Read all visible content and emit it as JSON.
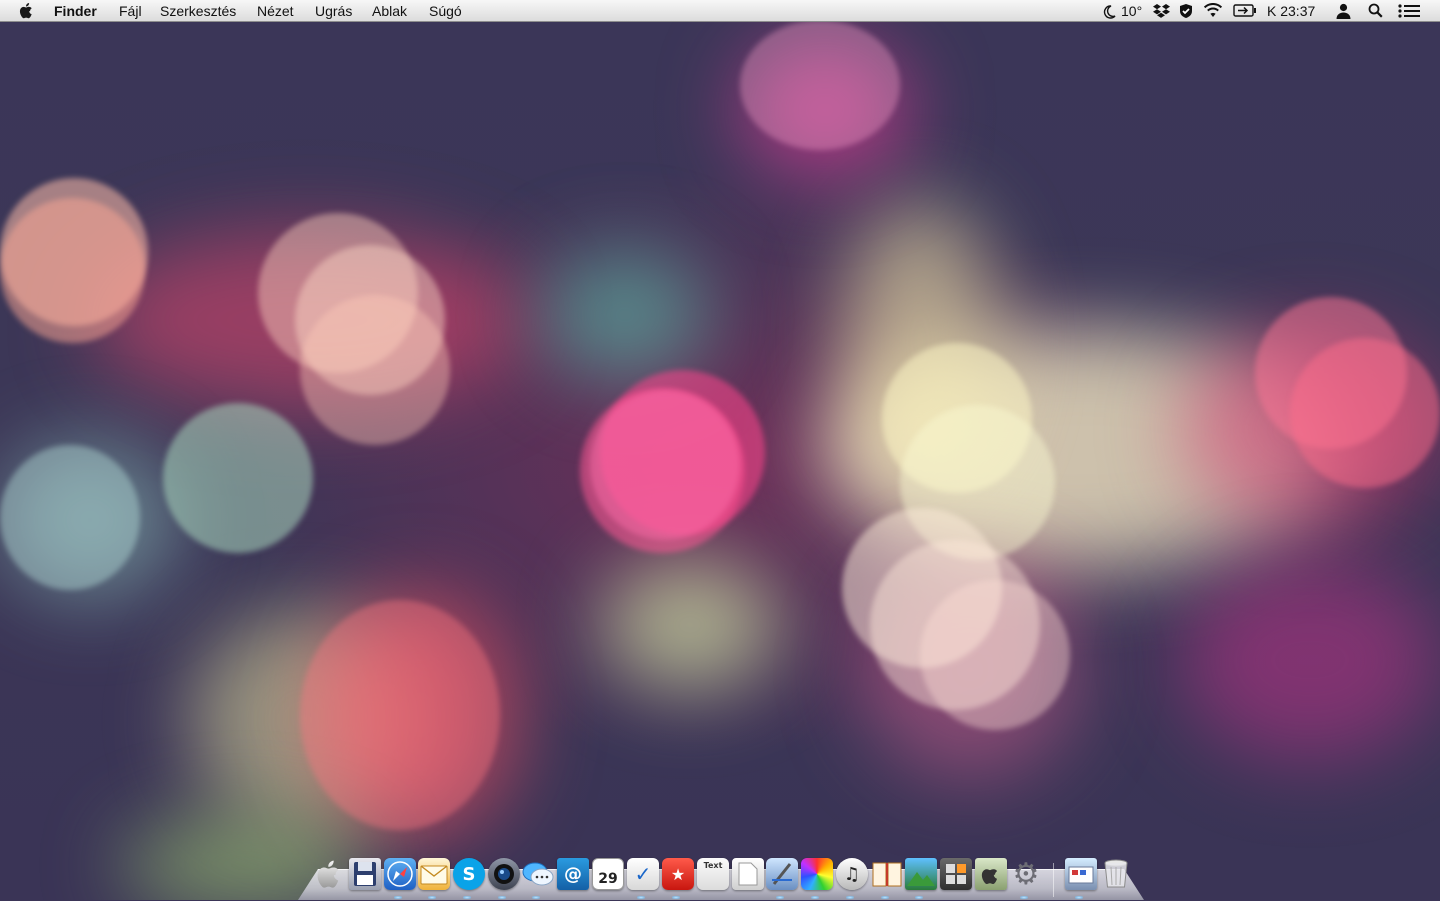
{
  "menubar": {
    "app_name": "Finder",
    "menus": [
      "Fájl",
      "Szerkesztés",
      "Nézet",
      "Ugrás",
      "Ablak",
      "Súgó"
    ],
    "status": {
      "weather": "10°",
      "clock": "K 23:37"
    }
  },
  "dock": {
    "items": [
      {
        "icon": "apple-icon",
        "name": "Apple"
      },
      {
        "icon": "floppy-icon",
        "name": "Floppy"
      },
      {
        "icon": "safari-icon",
        "name": "Safari"
      },
      {
        "icon": "mail-icon",
        "name": "Mail"
      },
      {
        "icon": "skype-icon",
        "name": "Skype",
        "glyph": "S"
      },
      {
        "icon": "camera-icon",
        "name": "Camera"
      },
      {
        "icon": "messages-icon",
        "name": "Messages"
      },
      {
        "icon": "address-book-icon",
        "name": "Address Book",
        "glyph": "@"
      },
      {
        "icon": "calendar-icon",
        "name": "Calendar",
        "glyph": "29"
      },
      {
        "icon": "reminders-icon",
        "name": "Reminders",
        "glyph": "✓"
      },
      {
        "icon": "bookmark-star-icon",
        "name": "Bookmarks",
        "glyph": "★"
      },
      {
        "icon": "textedit-icon",
        "name": "TextEdit",
        "glyph": "Text"
      },
      {
        "icon": "preview-icon",
        "name": "Preview"
      },
      {
        "icon": "xcode-icon",
        "name": "Xcode"
      },
      {
        "icon": "color-wheel-icon",
        "name": "Colors"
      },
      {
        "icon": "itunes-icon",
        "name": "iTunes",
        "glyph": "♫"
      },
      {
        "icon": "ibooks-icon",
        "name": "iBooks"
      },
      {
        "icon": "photos-icon",
        "name": "Photos"
      },
      {
        "icon": "calculator-icon",
        "name": "Calculator"
      },
      {
        "icon": "utility-icon",
        "name": "Utility"
      },
      {
        "icon": "system-preferences-icon",
        "name": "System Preferences",
        "glyph": "⚙"
      },
      {
        "icon": "downloads-stack-icon",
        "name": "Downloads"
      },
      {
        "icon": "trash-icon",
        "name": "Trash"
      }
    ],
    "running": [
      2,
      3,
      4,
      5,
      6,
      9,
      10,
      13,
      14,
      15,
      16,
      17,
      20,
      21
    ]
  },
  "colors": {
    "wallpaper_base": "#3b3658",
    "menubar_top": "#f7f7f7",
    "menubar_bottom": "#dcdcdc"
  }
}
